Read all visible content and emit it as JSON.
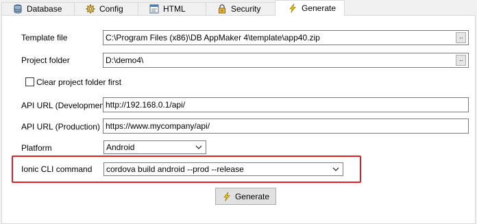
{
  "tabs": [
    {
      "label": "Database",
      "icon": "database-icon"
    },
    {
      "label": "Config",
      "icon": "gear-icon"
    },
    {
      "label": "HTML",
      "icon": "html-icon"
    },
    {
      "label": "Security",
      "icon": "lock-icon"
    },
    {
      "label": "Generate",
      "icon": "lightning-icon",
      "active": true
    }
  ],
  "form": {
    "template_file": {
      "label": "Template file",
      "value": "C:\\Program Files (x86)\\DB AppMaker 4\\template\\app40.zip",
      "button": "..."
    },
    "project_folder": {
      "label": "Project folder",
      "value": "D:\\demo4\\",
      "button": "..."
    },
    "clear_folder": {
      "label": "Clear project folder first",
      "checked": false
    },
    "api_dev": {
      "label": "API URL (Development)",
      "value": "http://192.168.0.1/api/"
    },
    "api_prod": {
      "label": "API URL (Production)",
      "value": "https://www.mycompany/api/"
    },
    "platform": {
      "label": "Platform",
      "value": "Android"
    },
    "ionic_cli": {
      "label": "Ionic CLI command",
      "value": "cordova build android --prod --release"
    }
  },
  "generate_button": {
    "label": "Generate"
  },
  "colors": {
    "highlight": "#e02020",
    "lightning": "#f2c200"
  }
}
